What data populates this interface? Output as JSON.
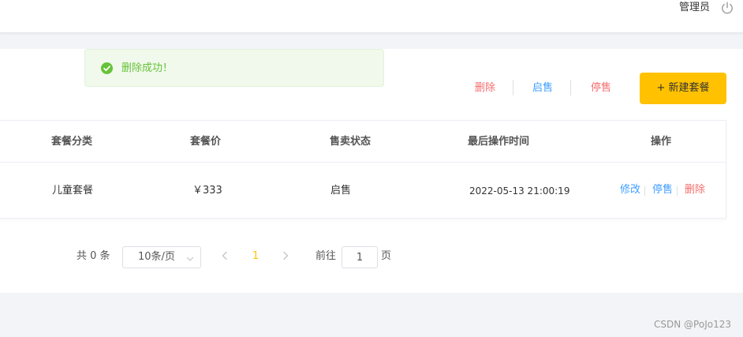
{
  "header": {
    "user_name": "管理员",
    "logout_icon": "power-icon"
  },
  "toast": {
    "message": "删除成功！",
    "icon": "check-circle-icon",
    "color": "#67c23a"
  },
  "toolbar": {
    "delete_label": "删除",
    "onsale_label": "启售",
    "stop_label": "停售",
    "new_button_label": "+ 新建套餐",
    "accent_color": "#ffc100"
  },
  "table": {
    "columns": [
      "套餐分类",
      "套餐价",
      "售卖状态",
      "最后操作时间",
      "操作"
    ],
    "rows": [
      {
        "category": "儿童套餐",
        "price": "￥333",
        "status": "启售",
        "updated_at": "2022-05-13 21:00:19",
        "actions": [
          "修改",
          "停售",
          "删除"
        ]
      }
    ]
  },
  "pagination": {
    "total_text": "共 0 条",
    "page_size": "10条/页",
    "current_page": "1",
    "goto_label": "前往",
    "goto_value": "1",
    "page_unit": "页"
  },
  "watermark": "CSDN @PoJo123"
}
